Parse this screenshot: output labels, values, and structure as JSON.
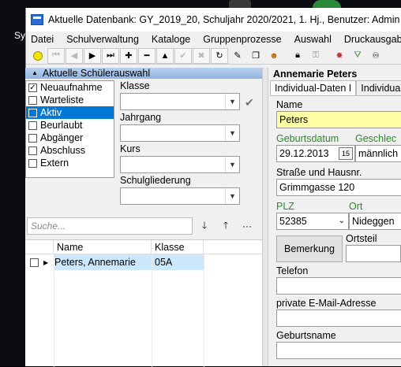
{
  "window": {
    "title": "Aktuelle Datenbank: GY_2019_20, Schuljahr 2020/2021, 1. Hj., Benutzer: Admin"
  },
  "desktop": {
    "text": "Sy"
  },
  "menu": [
    "Datei",
    "Schulverwaltung",
    "Kataloge",
    "Gruppenprozesse",
    "Auswahl",
    "Druckausgabe"
  ],
  "left_panel": {
    "header": "Aktuelle Schülerauswahl",
    "status_items": [
      {
        "label": "Neuaufnahme",
        "checked": true,
        "selected": false
      },
      {
        "label": "Warteliste",
        "checked": false,
        "selected": false
      },
      {
        "label": "Aktiv",
        "checked": false,
        "selected": true
      },
      {
        "label": "Beurlaubt",
        "checked": false,
        "selected": false
      },
      {
        "label": "Abgänger",
        "checked": false,
        "selected": false
      },
      {
        "label": "Abschluss",
        "checked": false,
        "selected": false
      },
      {
        "label": "Extern",
        "checked": false,
        "selected": false
      }
    ],
    "filters": {
      "klasse_label": "Klasse",
      "jahrgang_label": "Jahrgang",
      "kurs_label": "Kurs",
      "schulgliederung_label": "Schulgliederung"
    },
    "search": {
      "placeholder": "Suche..."
    },
    "grid": {
      "headers": {
        "name": "Name",
        "klasse": "Klasse"
      },
      "rows": [
        {
          "name": "Peters, Annemarie",
          "klasse": "05A"
        }
      ]
    }
  },
  "right_panel": {
    "student_name": "Annemarie Peters",
    "tabs": [
      "Individual-Daten I",
      "Individua"
    ],
    "fields": {
      "name_label": "Name",
      "name_value": "Peters",
      "geburtsdatum_label": "Geburtsdatum",
      "geburtsdatum_value": "29.12.2013",
      "geschlecht_label": "Geschlec",
      "geschlecht_value": "männlich",
      "strasse_label": "Straße und Hausnr.",
      "strasse_value": "Grimmgasse 120",
      "plz_label": "PLZ",
      "plz_value": "52385",
      "ort_label": "Ort",
      "ort_value": "Nideggen",
      "ortsteil_label": "Ortsteil",
      "bemerkung_button": "Bemerkung",
      "telefon_label": "Telefon",
      "email_label": "private E-Mail-Adresse",
      "geburtsname_label": "Geburtsname",
      "calendar_icon_text": "15"
    }
  }
}
